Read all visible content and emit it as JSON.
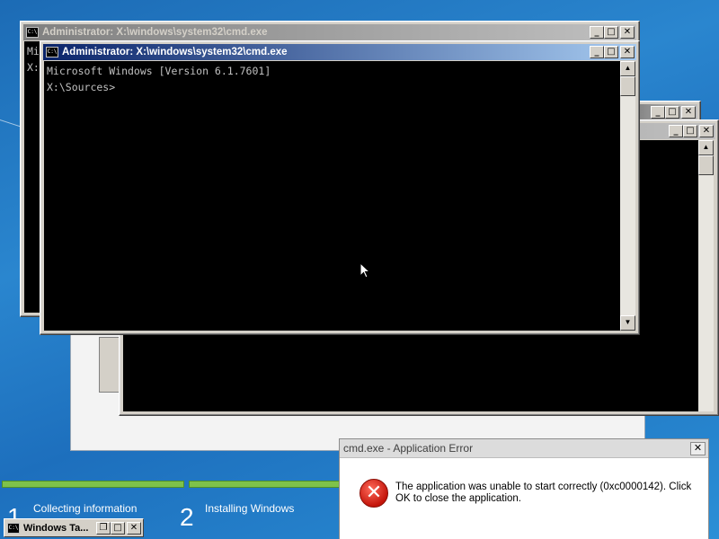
{
  "windows": {
    "back": {
      "title": "Administrator: X:\\windows\\system32\\cmd.exe",
      "partial_lines": [
        "Mi",
        "",
        "X:"
      ]
    },
    "front": {
      "title": "Administrator: X:\\windows\\system32\\cmd.exe",
      "console_lines": [
        "Microsoft Windows [Version 6.1.7601]",
        "",
        "X:\\Sources>"
      ]
    }
  },
  "title_buttons": {
    "minimize": "_",
    "maximize": "□",
    "close": "✕",
    "restore": "❐"
  },
  "icon": {
    "console": "C:\\"
  },
  "setup": {
    "steps": [
      {
        "number": "1",
        "label": "Collecting information"
      },
      {
        "number": "2",
        "label": "Installing Windows"
      }
    ]
  },
  "taskbar": {
    "minimized_title": "Windows Ta..."
  },
  "error_dialog": {
    "title": "cmd.exe - Application Error",
    "message": "The application was unable to start correctly (0xc0000142). Click OK to close the application.",
    "icon": "error-icon",
    "icon_glyph": "✕"
  },
  "colors": {
    "active_title": "#0a246a",
    "console_bg": "#000000",
    "desktop": "#1c6bb5",
    "progress": "#7ec24a"
  }
}
